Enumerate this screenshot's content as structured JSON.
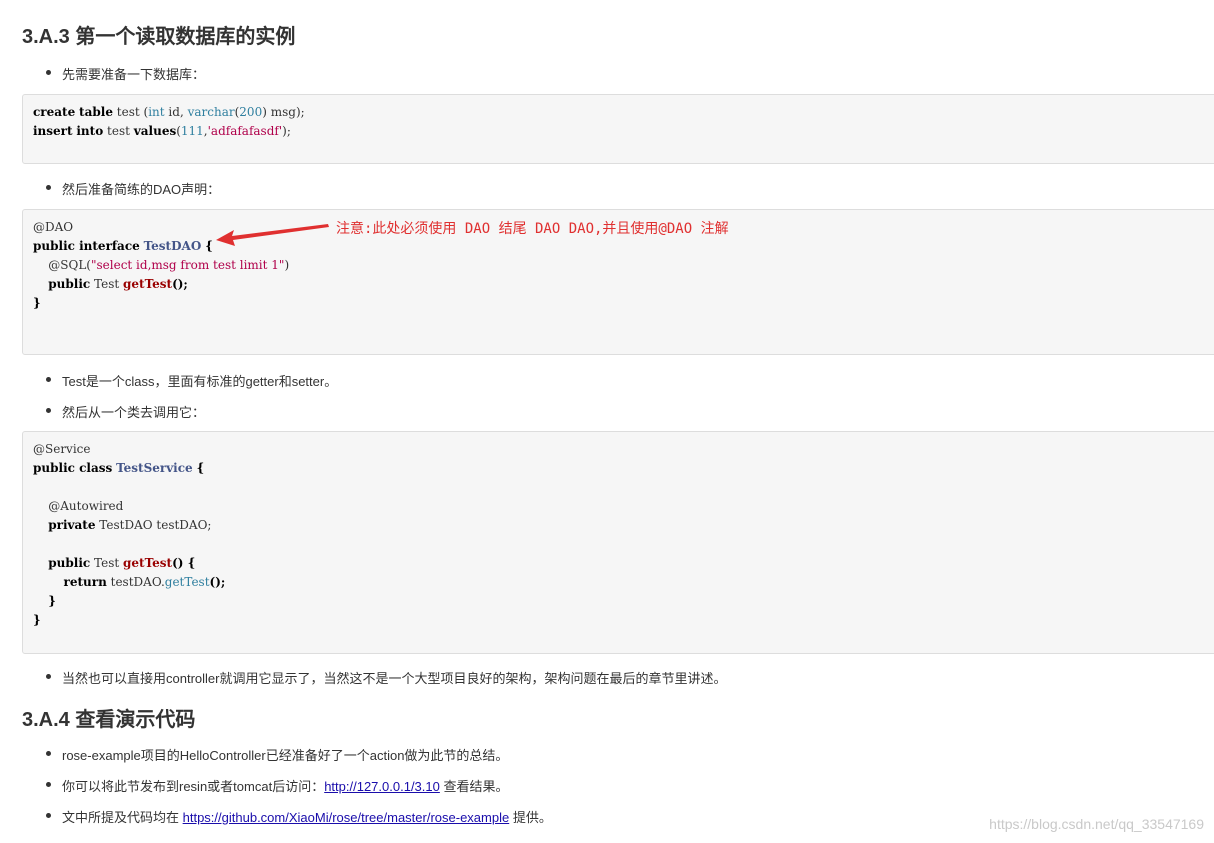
{
  "section_1": {
    "heading": "3.A.3 第一个读取数据库的实例",
    "bullet_1": "先需要准备一下数据库：",
    "code_1": {
      "line1": [
        "create",
        "table",
        "test",
        "(",
        "int",
        "id,",
        "varchar",
        "(",
        "200",
        ")",
        "msg);"
      ],
      "line2": [
        "insert",
        "into",
        "test",
        "values",
        "(",
        "111",
        ",",
        "'adfafafasdf'",
        ");"
      ]
    },
    "bullet_2": "然后准备简练的DAO声明：",
    "code_2": {
      "l1": "@DAO",
      "l2_kw": "public interface",
      "l2_name": "TestDAO",
      "l2_end": "{",
      "l3_ann": "@SQL(",
      "l3_str": "\"select id,msg from test limit 1\"",
      "l3_end": ")",
      "l4_kw": "public",
      "l4_type": "Test",
      "l4_fn": "getTest",
      "l4_end": "();",
      "l5": "}"
    },
    "annotation_note": "注意:此处必须使用 DAO 结尾  DAO DAO,并且使用@DAO 注解",
    "bullet_3": "Test是一个class，里面有标准的getter和setter。",
    "bullet_4": "然后从一个类去调用它：",
    "code_3": {
      "l1": "@Service",
      "l2_kw": "public class",
      "l2_name": "TestService",
      "l2_end": "{",
      "l4": "@Autowired",
      "l5_kw": "private",
      "l5_rest": "TestDAO testDAO;",
      "l7_kw": "public",
      "l7_type": "Test",
      "l7_fn": "getTest",
      "l7_end": "() {",
      "l8_kw": "return",
      "l8_obj": "testDAO.",
      "l8_call": "getTest",
      "l8_end": "();",
      "l9": "}",
      "l10": "}"
    },
    "bullet_5": "当然也可以直接用controller就调用它显示了，当然这不是一个大型项目良好的架构，架构问题在最后的章节里讲述。"
  },
  "section_2": {
    "heading": "3.A.4 查看演示代码",
    "bullet_1": "rose-example项目的HelloController已经准备好了一个action做为此节的总结。",
    "bullet_2_pre": "你可以将此节发布到resin或者tomcat后访问：",
    "bullet_2_link": "http://127.0.0.1/3.10",
    "bullet_2_post": " 查看结果。",
    "bullet_3_pre": "文中所提及代码均在 ",
    "bullet_3_link": "https://github.com/XiaoMi/rose/tree/master/rose-example",
    "bullet_3_post": " 提供。"
  },
  "watermark": "https://blog.csdn.net/qq_33547169",
  "colors": {
    "annotation": "#e03030",
    "link": "#1a0dab",
    "code_bg": "#f6f6f6"
  }
}
